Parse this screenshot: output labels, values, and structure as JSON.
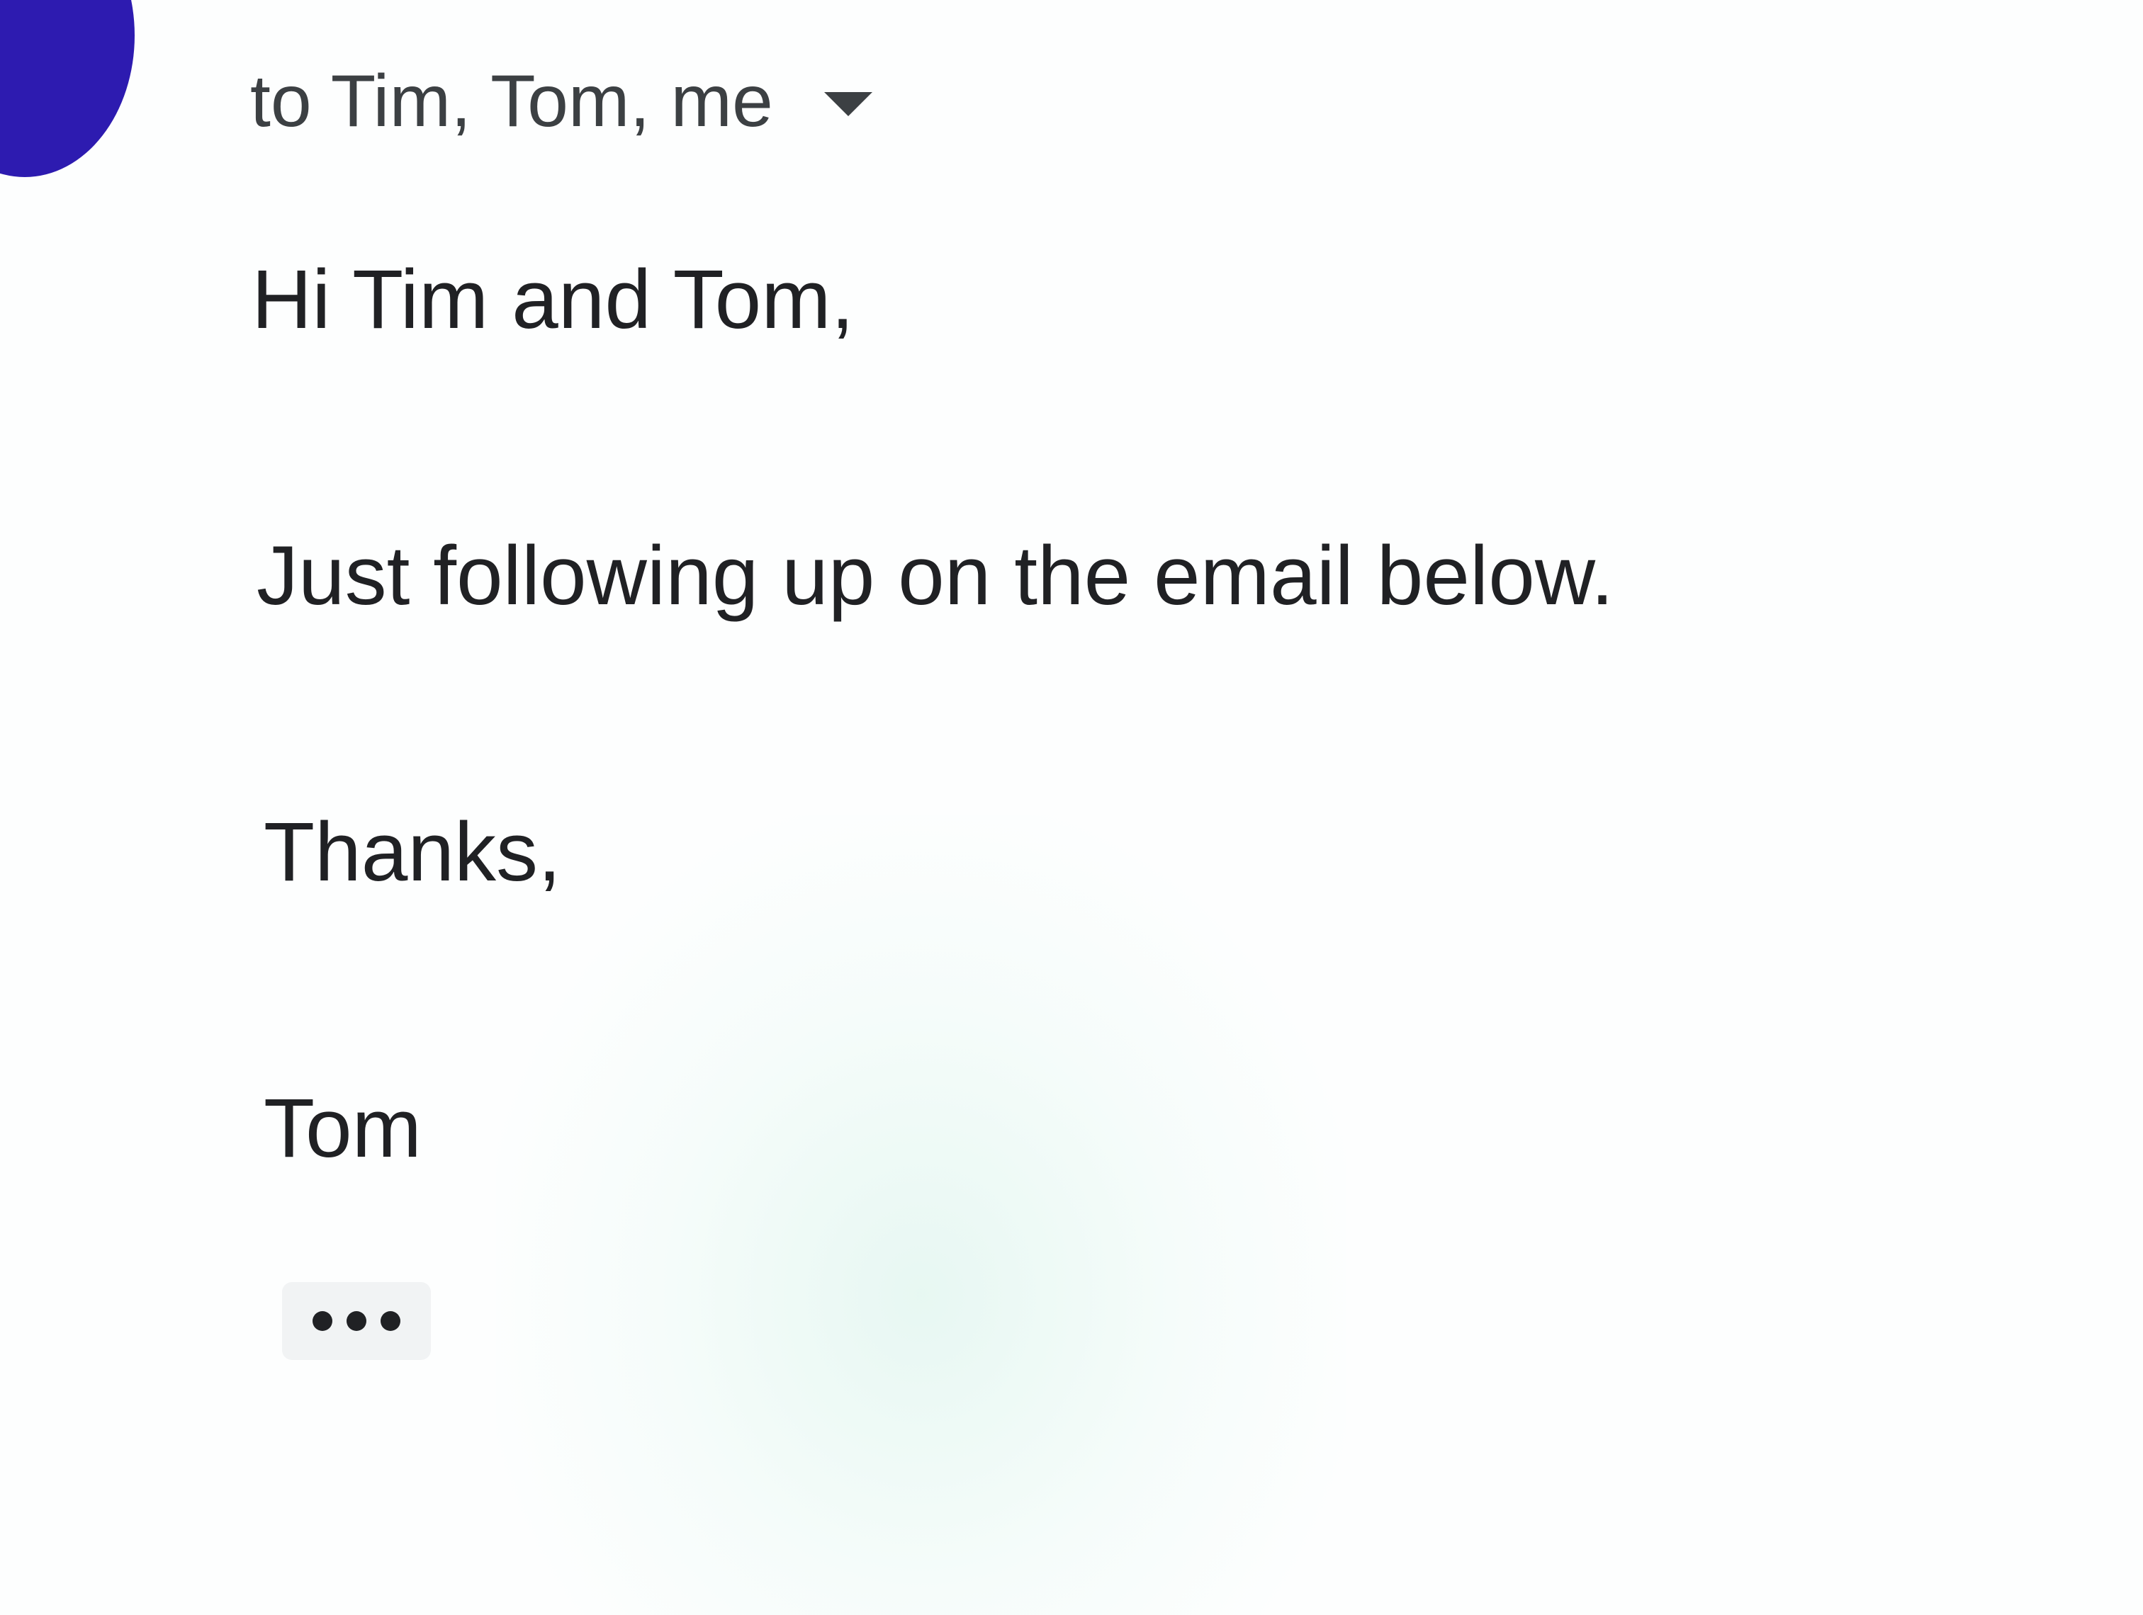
{
  "header": {
    "recipients_label": "to Tim, Tom, me",
    "avatar_color": "#2d1bb0",
    "details_icon": "caret-down-icon"
  },
  "message": {
    "greeting": "Hi Tim and Tom,",
    "body": "Just following up on the email below.",
    "signoff": "Thanks,",
    "signature": "Tom"
  },
  "trimmed_content": {
    "icon": "more-horizontal-icon"
  }
}
